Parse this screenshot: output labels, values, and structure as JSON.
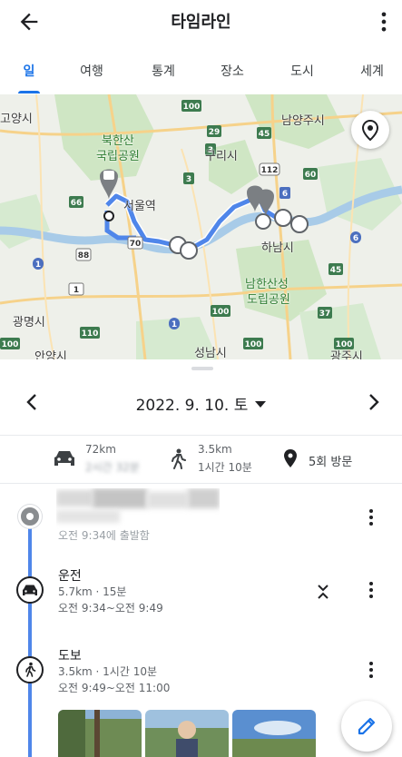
{
  "appbar": {
    "title": "타임라인",
    "back_icon": "arrow-back-icon",
    "more_icon": "more-vert-icon"
  },
  "tabs": [
    {
      "label": "일",
      "active": true
    },
    {
      "label": "여행",
      "active": false
    },
    {
      "label": "통계",
      "active": false
    },
    {
      "label": "장소",
      "active": false
    },
    {
      "label": "도시",
      "active": false
    },
    {
      "label": "세계",
      "active": false
    }
  ],
  "map": {
    "labels": {
      "goyang": "고양시",
      "namyangju": "남양주시",
      "bukhansan": "북한산",
      "park": "국립공원",
      "guri": "구리시",
      "seoul_station": "서울역",
      "hanam": "하남시",
      "namhansan": "남한산성",
      "dorip": "도립공원",
      "gwangmyeong": "광명시",
      "anyang": "안양시",
      "seongnam": "성남시",
      "gwangju": "광주시"
    },
    "route_badges": {
      "r100a": "100",
      "r100b": "100",
      "r100c": "100",
      "r45": "45",
      "r29": "29",
      "r112": "112",
      "r60": "60",
      "r3a": "3",
      "r3b": "3",
      "r66": "66",
      "r6a": "6",
      "r6b": "6",
      "r70": "70",
      "r88": "88",
      "r1a": "1",
      "r1b": "1",
      "r1c": "1",
      "r45b": "45",
      "r37": "37",
      "r110": "110",
      "r100d": "100",
      "r100e": "100"
    },
    "location_button_icon": "place-icon",
    "accent": "#1a73e8"
  },
  "date_nav": {
    "date": "2022. 9. 10. 토"
  },
  "summary": {
    "drive": {
      "icon": "car-icon",
      "distance": "72km",
      "duration": "2시간 32분"
    },
    "walk": {
      "icon": "walk-icon",
      "distance": "3.5km",
      "duration": "1시간 10분"
    },
    "visits": {
      "icon": "place-icon",
      "text": "5회 방문"
    }
  },
  "timeline": {
    "start": {
      "sub": "오전 9:34에 출발함"
    },
    "drive": {
      "title": "운전",
      "detail": "5.7km · 15분",
      "time": "오전 9:34~오전 9:49"
    },
    "walk": {
      "title": "도보",
      "detail": "3.5km · 1시간 10분",
      "time": "오전 9:49~오전 11:00"
    }
  },
  "fab": {
    "icon": "edit-icon"
  },
  "colors": {
    "route": "#4f86ea",
    "accent": "#1a73e8"
  }
}
